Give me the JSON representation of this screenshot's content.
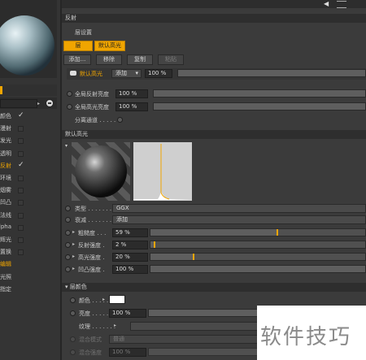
{
  "left_panel": {
    "items": [
      {
        "label": "颜色",
        "checked": true
      },
      {
        "label": "漫射",
        "checked": false
      },
      {
        "label": "发光",
        "checked": false
      },
      {
        "label": "透明",
        "checked": false
      },
      {
        "label": "反射",
        "checked": true,
        "active": true
      },
      {
        "label": "环境",
        "checked": false
      },
      {
        "label": "烟雾",
        "checked": false
      },
      {
        "label": "凹凸",
        "checked": false
      },
      {
        "label": "法线",
        "checked": false
      },
      {
        "label": "Alpha",
        "checked": false
      },
      {
        "label": "辉光",
        "checked": false
      },
      {
        "label": "置换",
        "checked": false
      },
      {
        "label": "编辑",
        "checked": false,
        "highlight": true
      },
      {
        "label": "光照",
        "checked": false
      },
      {
        "label": "指定",
        "checked": false
      }
    ]
  },
  "reflect": {
    "title": "反射",
    "layer_settings": "层设置",
    "tab_layer": "层",
    "tab_default_spec": "默认高光",
    "btn_add": "添加...",
    "btn_remove": "移除",
    "btn_copy": "复制",
    "btn_paste": "粘贴",
    "layer_row_name": "默认高光",
    "layer_row_mode": "添加",
    "layer_row_value": "100 %",
    "global_reflect_label": "全局反射亮度",
    "global_reflect_value": "100 %",
    "global_spec_label": "全局高光亮度",
    "global_spec_value": "100 %",
    "separate_passes": "分离通道 . . . . ."
  },
  "spec": {
    "title": "默认高光",
    "type_label": "类型 . . . . . . .",
    "type_value": "GGX",
    "atten_label": "衰减 . . . . . . .",
    "atten_value": "添加",
    "rough_label": "粗糙度 . . .",
    "rough_value": "59 %",
    "rough_level": 0.59,
    "refl_label": "反射强度 .",
    "refl_value": "2 %",
    "refl_level": 0.02,
    "spec_label": "高光强度 .",
    "spec_value": "20 %",
    "spec_level": 0.2,
    "bump_label": "凹凸强度 .",
    "bump_value": "100 %",
    "bump_level": 1.0
  },
  "layer_color": {
    "title": "▾ 层颜色",
    "color_label": "颜色 . . . . .",
    "brightness_label": "亮度 . . . . .",
    "brightness_value": "100 %",
    "texture_label": "纹理 . . . . . . .",
    "blend_mode_label": "混合模式",
    "blend_mode_value": "普通",
    "blend_strength_label": "混合强度",
    "blend_strength_value": "100 %"
  },
  "watermark": "软件技巧",
  "colors": {
    "accent": "#f0a500",
    "panel": "#3b3b3b",
    "dark": "#2b2b2b"
  }
}
